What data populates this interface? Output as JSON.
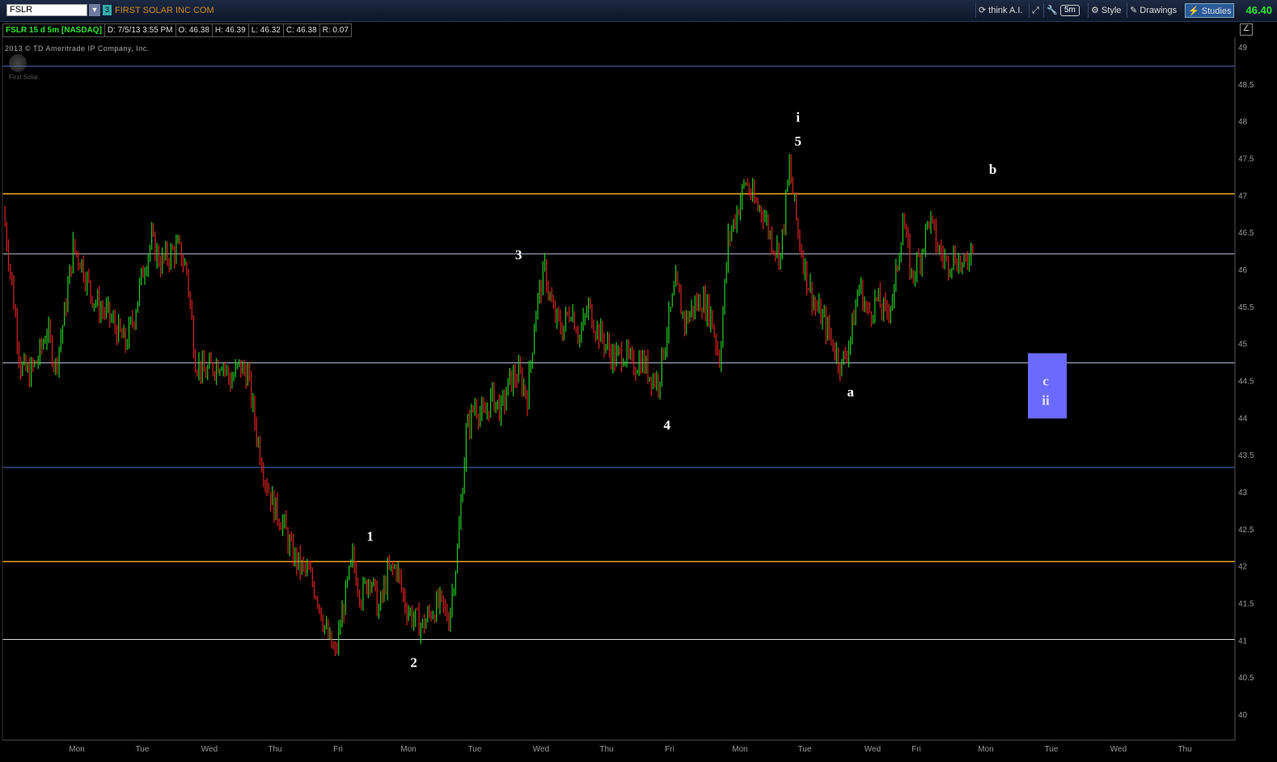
{
  "header": {
    "symbol": "FSLR",
    "link_badge": "3",
    "company": "FIRST SOLAR INC COM",
    "buttons": {
      "think_ai": "think A.I.",
      "interval": "5m",
      "style": "Style",
      "drawings": "Drawings",
      "studies": "Studies"
    },
    "last_price": "46.40"
  },
  "info_bar": {
    "title": "FSLR 15 d 5m [NASDAQ]",
    "date": "D: 7/5/13 3:55 PM",
    "open": "O: 46.38",
    "high": "H: 46.39",
    "low": "L: 46.32",
    "close": "C: 46.38",
    "range": "R: 0.07"
  },
  "copyright": "2013 © TD Ameritrade IP Company, Inc.",
  "logo_text": "First Solar.",
  "colors": {
    "up": "#22cc22",
    "down": "#dd2222",
    "orange_level": "#e8a020",
    "blue_level": "#4a6fc8",
    "white_level": "#dddddd",
    "box": "#6a6aff"
  },
  "chart_data": {
    "type": "candlestick",
    "symbol": "FSLR",
    "interval": "5m",
    "y_range": [
      40,
      49
    ],
    "y_ticks": [
      "49",
      "48.5",
      "48",
      "47.5",
      "47",
      "46.5",
      "46",
      "45.5",
      "45",
      "44.5",
      "44",
      "43.5",
      "43",
      "42.5",
      "42",
      "41.5",
      "41",
      "40.5",
      "40"
    ],
    "x_tick_labels": [
      "Mon",
      "Tue",
      "Wed",
      "Thu",
      "Fri",
      "Mon",
      "Tue",
      "Wed",
      "Thu",
      "Fri",
      "Mon",
      "Tue",
      "Wed",
      "Fri",
      "Mon",
      "Tue",
      "Wed",
      "Thu"
    ],
    "horizontal_levels": [
      {
        "price": 48.75,
        "color": "blue"
      },
      {
        "price": 47.03,
        "color": "orange"
      },
      {
        "price": 46.22,
        "color": "white-blue"
      },
      {
        "price": 44.75,
        "color": "white-blue"
      },
      {
        "price": 43.34,
        "color": "blue"
      },
      {
        "price": 42.07,
        "color": "orange"
      },
      {
        "price": 41.02,
        "color": "white"
      }
    ],
    "price_path": [
      [
        0,
        46.8
      ],
      [
        1,
        45.8
      ],
      [
        2,
        44.7
      ],
      [
        3,
        44.6
      ],
      [
        4,
        44.8
      ],
      [
        5,
        45.2
      ],
      [
        6,
        44.7
      ],
      [
        7,
        45.4
      ],
      [
        8,
        46.3
      ],
      [
        9,
        46.1
      ],
      [
        10,
        45.7
      ],
      [
        11,
        45.5
      ],
      [
        12,
        45.4
      ],
      [
        13,
        45.2
      ],
      [
        14,
        45.0
      ],
      [
        15,
        45.4
      ],
      [
        16,
        46.0
      ],
      [
        17,
        46.4
      ],
      [
        18,
        46.1
      ],
      [
        19,
        46.2
      ],
      [
        20,
        46.3
      ],
      [
        21,
        46.0
      ],
      [
        22,
        44.8
      ],
      [
        23,
        44.6
      ],
      [
        24,
        44.7
      ],
      [
        25,
        44.8
      ],
      [
        26,
        44.5
      ],
      [
        27,
        44.7
      ],
      [
        28,
        44.6
      ],
      [
        29,
        43.8
      ],
      [
        30,
        43.2
      ],
      [
        31,
        42.8
      ],
      [
        32,
        42.6
      ],
      [
        33,
        42.2
      ],
      [
        34,
        42.0
      ],
      [
        35,
        41.9
      ],
      [
        36,
        41.6
      ],
      [
        37,
        41.1
      ],
      [
        38,
        40.8
      ],
      [
        39,
        41.5
      ],
      [
        40,
        42.1
      ],
      [
        41,
        41.6
      ],
      [
        42,
        41.9
      ],
      [
        43,
        41.4
      ],
      [
        44,
        41.9
      ],
      [
        45,
        42.0
      ],
      [
        46,
        41.5
      ],
      [
        47,
        41.3
      ],
      [
        48,
        41.2
      ],
      [
        49,
        41.4
      ],
      [
        50,
        41.5
      ],
      [
        51,
        41.3
      ],
      [
        52,
        42.2
      ],
      [
        53,
        43.8
      ],
      [
        54,
        44.2
      ],
      [
        55,
        44.0
      ],
      [
        56,
        44.3
      ],
      [
        57,
        44.1
      ],
      [
        58,
        44.5
      ],
      [
        59,
        44.6
      ],
      [
        60,
        44.3
      ],
      [
        61,
        45.5
      ],
      [
        62,
        46.0
      ],
      [
        63,
        45.4
      ],
      [
        64,
        45.2
      ],
      [
        65,
        45.5
      ],
      [
        66,
        45.1
      ],
      [
        67,
        45.5
      ],
      [
        68,
        45.2
      ],
      [
        69,
        45.0
      ],
      [
        70,
        44.8
      ],
      [
        71,
        44.9
      ],
      [
        72,
        44.7
      ],
      [
        73,
        44.8
      ],
      [
        74,
        44.6
      ],
      [
        75,
        44.5
      ],
      [
        76,
        45.2
      ],
      [
        77,
        45.8
      ],
      [
        78,
        45.3
      ],
      [
        79,
        45.5
      ],
      [
        80,
        45.6
      ],
      [
        81,
        45.4
      ],
      [
        82,
        44.8
      ],
      [
        83,
        46.4
      ],
      [
        84,
        46.8
      ],
      [
        85,
        47.2
      ],
      [
        86,
        46.9
      ],
      [
        87,
        46.8
      ],
      [
        88,
        46.4
      ],
      [
        89,
        46.2
      ],
      [
        90,
        47.4
      ],
      [
        91,
        46.5
      ],
      [
        92,
        45.9
      ],
      [
        93,
        45.5
      ],
      [
        94,
        45.3
      ],
      [
        95,
        45.0
      ],
      [
        96,
        44.7
      ],
      [
        97,
        45.1
      ],
      [
        98,
        45.8
      ],
      [
        99,
        45.4
      ],
      [
        100,
        45.6
      ],
      [
        101,
        45.4
      ],
      [
        102,
        45.7
      ],
      [
        103,
        46.7
      ],
      [
        104,
        45.9
      ],
      [
        105,
        46.2
      ],
      [
        106,
        46.7
      ],
      [
        107,
        46.3
      ],
      [
        108,
        46.1
      ],
      [
        109,
        46.2
      ],
      [
        110,
        46.0
      ],
      [
        111,
        46.4
      ]
    ],
    "wave_labels": [
      {
        "text": "1",
        "x": 42,
        "price": 42.35
      },
      {
        "text": "2",
        "x": 47,
        "price": 40.65
      },
      {
        "text": "3",
        "x": 59,
        "price": 46.15
      },
      {
        "text": "4",
        "x": 76,
        "price": 43.85
      },
      {
        "text": "5",
        "x": 91,
        "price": 47.68
      },
      {
        "text": "i",
        "x": 91,
        "price": 48.0
      },
      {
        "text": "a",
        "x": 97,
        "price": 44.3
      },
      {
        "text": "b",
        "x": 112,
        "price": 47.3
      }
    ],
    "projection_box": {
      "labels": [
        "c",
        "ii"
      ],
      "x_from": 118,
      "x_to": 122,
      "price_top": 44.88,
      "price_bottom": 44.0
    }
  }
}
